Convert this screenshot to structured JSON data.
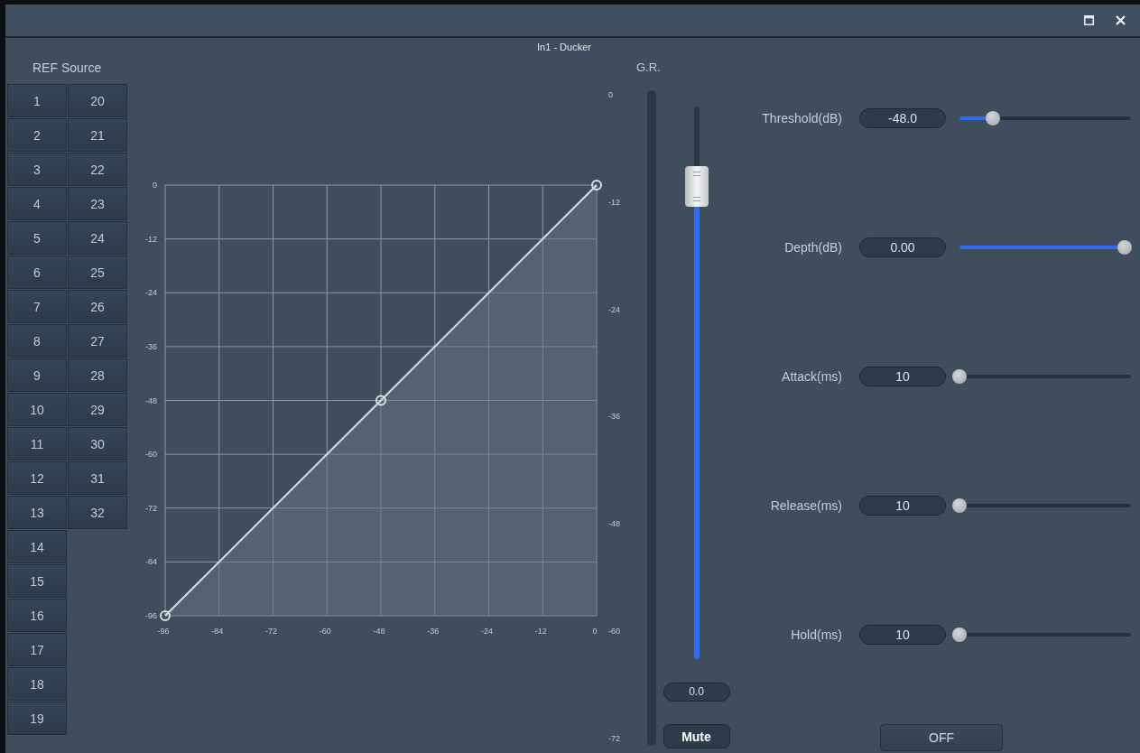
{
  "window": {
    "title": "In1 - Ducker"
  },
  "ref_source": {
    "label": "REF Source",
    "items": [
      {
        "label": "1",
        "selected": false
      },
      {
        "label": "2",
        "selected": false
      },
      {
        "label": "3",
        "selected": false
      },
      {
        "label": "4",
        "selected": false
      },
      {
        "label": "5",
        "selected": false
      },
      {
        "label": "6",
        "selected": false
      },
      {
        "label": "7",
        "selected": false
      },
      {
        "label": "8",
        "selected": false
      },
      {
        "label": "9",
        "selected": false
      },
      {
        "label": "10",
        "selected": false
      },
      {
        "label": "11",
        "selected": false
      },
      {
        "label": "12",
        "selected": false
      },
      {
        "label": "13",
        "selected": false
      },
      {
        "label": "14",
        "selected": false
      },
      {
        "label": "15",
        "selected": false
      },
      {
        "label": "16",
        "selected": false
      },
      {
        "label": "17",
        "selected": false
      },
      {
        "label": "18",
        "selected": false
      },
      {
        "label": "19",
        "selected": false
      },
      {
        "label": "20",
        "selected": false
      },
      {
        "label": "21",
        "selected": false
      },
      {
        "label": "22",
        "selected": false
      },
      {
        "label": "23",
        "selected": false
      },
      {
        "label": "24",
        "selected": false
      },
      {
        "label": "25",
        "selected": false
      },
      {
        "label": "26",
        "selected": false
      },
      {
        "label": "27",
        "selected": false
      },
      {
        "label": "28",
        "selected": false
      },
      {
        "label": "29",
        "selected": false
      },
      {
        "label": "30",
        "selected": false
      },
      {
        "label": "31",
        "selected": false
      },
      {
        "label": "32",
        "selected": false
      }
    ]
  },
  "transfer_curve": {
    "chart_data": {
      "type": "line",
      "x": [
        -96,
        -48,
        0
      ],
      "series": [
        {
          "color": "#d9dee4",
          "marker": "circle",
          "values": [
            -96,
            -48,
            0
          ]
        }
      ],
      "grid": true,
      "xlim": [
        -96,
        0
      ],
      "ylim": [
        -96,
        0
      ],
      "xticks": [
        -96,
        -84,
        -72,
        -60,
        -48,
        -36,
        -24,
        -12,
        0
      ],
      "yticks": [
        0,
        -12,
        -24,
        -36,
        -48,
        -60,
        -72,
        -84,
        -96
      ]
    }
  },
  "gr_meter": {
    "label": "G.R.",
    "scale": [
      "0",
      "-12",
      "-24",
      "-36",
      "-48",
      "-60",
      "-72"
    ]
  },
  "fader": {
    "level": 0.855,
    "value": "0.0",
    "mute_label": "Mute"
  },
  "parameters": [
    {
      "label": "Threshold(dB)",
      "value": "-48.0",
      "level": 0.2
    },
    {
      "label": "Depth(dB)",
      "value": "0.00",
      "level": 1
    },
    {
      "label": "Attack(ms)",
      "value": "10",
      "level": 0
    },
    {
      "label": "Release(ms)",
      "value": "10",
      "level": 0
    },
    {
      "label": "Hold(ms)",
      "value": "10",
      "level": 0
    }
  ],
  "bypass_button": "OFF"
}
